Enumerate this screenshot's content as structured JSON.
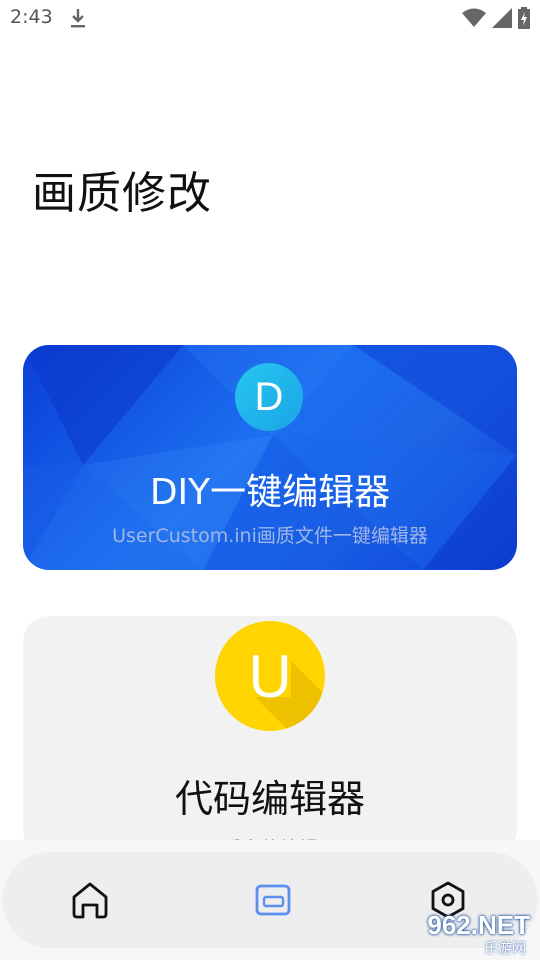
{
  "status_bar": {
    "time": "2:43",
    "icons": [
      "download-icon",
      "wifi-icon",
      "signal-icon",
      "battery-charging-icon"
    ]
  },
  "page": {
    "title": "画质修改"
  },
  "cards": [
    {
      "badge_letter": "D",
      "title": "DIY一键编辑器",
      "subtitle": "UserCustom.ini画质文件一键编辑器",
      "badge_color": "#1fb5ec",
      "background": "#1a5fe8"
    },
    {
      "badge_letter": "U",
      "title": "代码编辑器",
      "subtitle": "画质文件编辑器",
      "badge_color": "#ffd400",
      "background": "#f2f2f2"
    }
  ],
  "bottom_nav": {
    "items": [
      {
        "icon": "home-icon",
        "active": false
      },
      {
        "icon": "editor-icon",
        "active": true
      },
      {
        "icon": "settings-icon",
        "active": false
      }
    ],
    "active_color": "#5b8ff0"
  },
  "watermark": {
    "text": "962.NET",
    "sub": "乐游网"
  }
}
